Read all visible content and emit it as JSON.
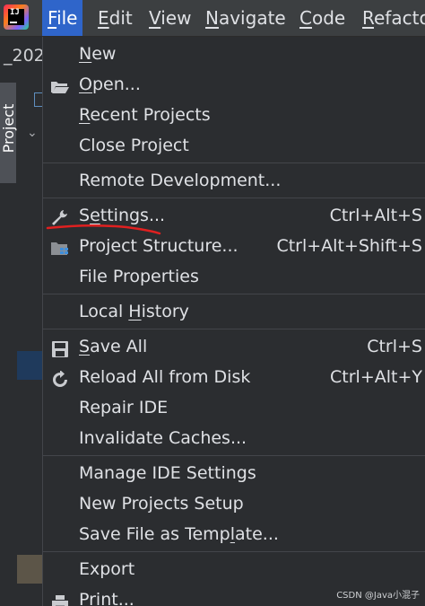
{
  "menubar": {
    "items": [
      {
        "label": "File"
      },
      {
        "label": "Edit"
      },
      {
        "label": "View"
      },
      {
        "label": "Navigate"
      },
      {
        "label": "Code"
      },
      {
        "label": "Refacto"
      }
    ]
  },
  "sidebar": {
    "project_prefix": "_202",
    "project_tab": "Project"
  },
  "file_menu": {
    "new": "New",
    "open": "Open...",
    "recent_projects": "Recent Projects",
    "close_project": "Close Project",
    "remote_development": "Remote Development...",
    "settings": {
      "label": "Settings...",
      "shortcut": "Ctrl+Alt+S"
    },
    "project_structure": {
      "label": "Project Structure...",
      "shortcut": "Ctrl+Alt+Shift+S"
    },
    "file_properties": "File Properties",
    "local_history": "Local History",
    "save_all": {
      "label": "Save All",
      "shortcut": "Ctrl+S"
    },
    "reload_all": {
      "label": "Reload All from Disk",
      "shortcut": "Ctrl+Alt+Y"
    },
    "repair_ide": "Repair IDE",
    "invalidate_caches": "Invalidate Caches...",
    "manage_ide_settings": "Manage IDE Settings",
    "new_projects_setup": "New Projects Setup",
    "save_file_as_template": "Save File as Template...",
    "export": "Export",
    "print": "Print..."
  },
  "watermark": "CSDN @Java小混子",
  "colors": {
    "menubar_bg": "#3c3f41",
    "active_menu": "#2f65ca",
    "menu_bg": "#2b2d30",
    "annotation_red": "#e02020"
  }
}
